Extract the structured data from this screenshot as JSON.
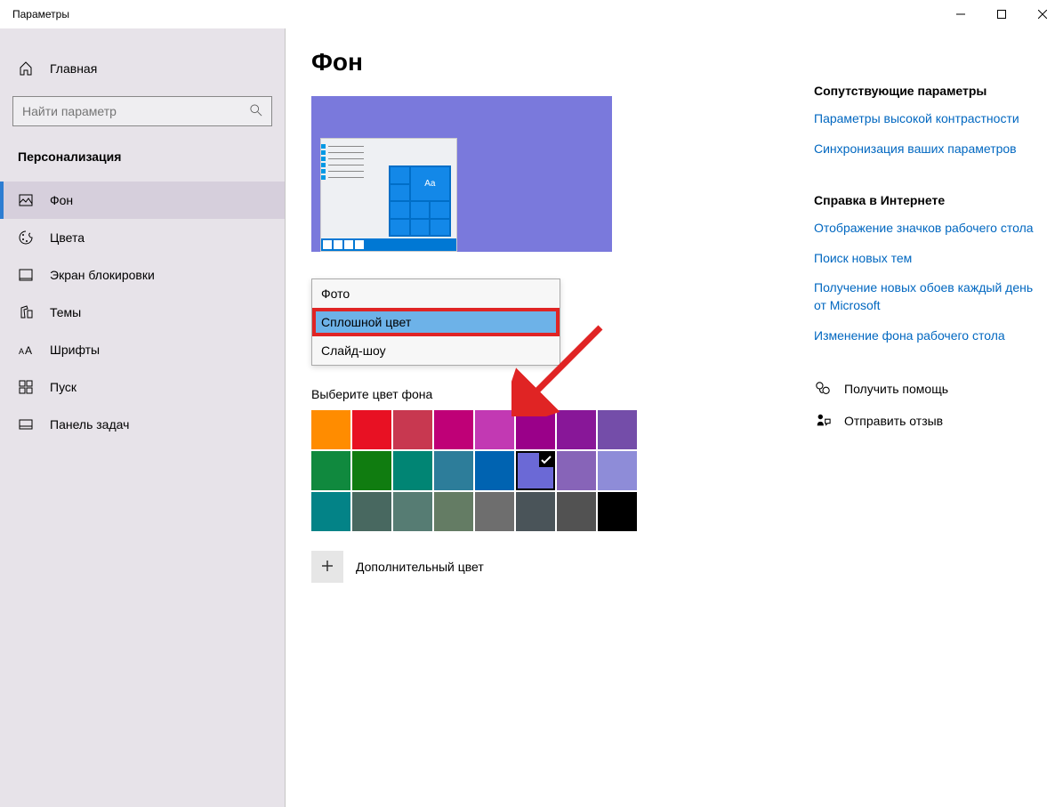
{
  "titlebar": {
    "title": "Параметры"
  },
  "sidebar": {
    "home": "Главная",
    "search_placeholder": "Найти параметр",
    "section": "Персонализация",
    "items": [
      {
        "label": "Фон",
        "active": true,
        "icon": "picture"
      },
      {
        "label": "Цвета",
        "active": false,
        "icon": "palette"
      },
      {
        "label": "Экран блокировки",
        "active": false,
        "icon": "lockscreen"
      },
      {
        "label": "Темы",
        "active": false,
        "icon": "themes"
      },
      {
        "label": "Шрифты",
        "active": false,
        "icon": "fonts"
      },
      {
        "label": "Пуск",
        "active": false,
        "icon": "start"
      },
      {
        "label": "Панель задач",
        "active": false,
        "icon": "taskbar"
      }
    ]
  },
  "main": {
    "title": "Фон",
    "preview_tile_text": "Aa",
    "dropdown": {
      "options": [
        {
          "label": "Фото",
          "selected": false
        },
        {
          "label": "Сплошной цвет",
          "selected": true
        },
        {
          "label": "Слайд-шоу",
          "selected": false
        }
      ]
    },
    "color_section_label": "Выберите цвет фона",
    "colors": [
      "#ff8c00",
      "#e81123",
      "#c83850",
      "#bf0077",
      "#c239b3",
      "#9a0089",
      "#881798",
      "#744da9",
      "#10893e",
      "#107c10",
      "#018574",
      "#2d7d9a",
      "#0063b1",
      "#6b69d6",
      "#8764b8",
      "#8e8cd8",
      "#038387",
      "#486860",
      "#567c73",
      "#647c64",
      "#6e6e6e",
      "#4a5459",
      "#525252",
      "#000000"
    ],
    "selected_color_index": 13,
    "custom_color_label": "Дополнительный цвет"
  },
  "right": {
    "related_heading": "Сопутствующие параметры",
    "related_links": [
      "Параметры высокой контрастности",
      "Синхронизация ваших параметров"
    ],
    "help_heading": "Справка в Интернете",
    "help_links": [
      "Отображение значков рабочего стола",
      "Поиск новых тем",
      "Получение новых обоев каждый день от Microsoft",
      "Изменение фона рабочего стола"
    ],
    "get_help": "Получить помощь",
    "feedback": "Отправить отзыв"
  }
}
